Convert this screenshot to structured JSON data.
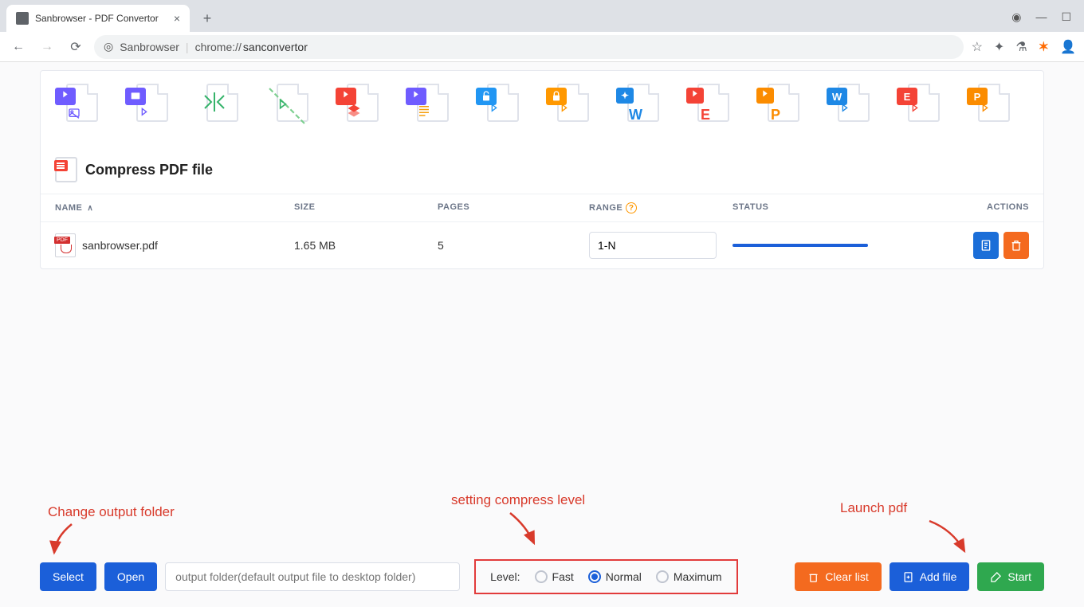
{
  "browser": {
    "tab_title": "Sanbrowser - PDF Convertor",
    "url_prefix": "Sanbrowser",
    "url_path": "chrome://",
    "url_bold": "sanconvertor"
  },
  "section": {
    "title": "Compress PDF file"
  },
  "columns": {
    "name": "NAME",
    "size": "SIZE",
    "pages": "PAGES",
    "range": "RANGE",
    "status": "STATUS",
    "actions": "ACTIONS"
  },
  "row": {
    "filename": "sanbrowser.pdf",
    "size": "1.65 MB",
    "pages": "5",
    "range": "1-N"
  },
  "level": {
    "label": "Level:",
    "fast": "Fast",
    "normal": "Normal",
    "maximum": "Maximum"
  },
  "buttons": {
    "select": "Select",
    "open": "Open",
    "clear": "Clear list",
    "add": "Add file",
    "start": "Start"
  },
  "output_placeholder": "output folder(default output file to desktop folder)",
  "annotations": {
    "a1": "Change output folder",
    "a2": "setting compress level",
    "a3": "Launch pdf"
  }
}
